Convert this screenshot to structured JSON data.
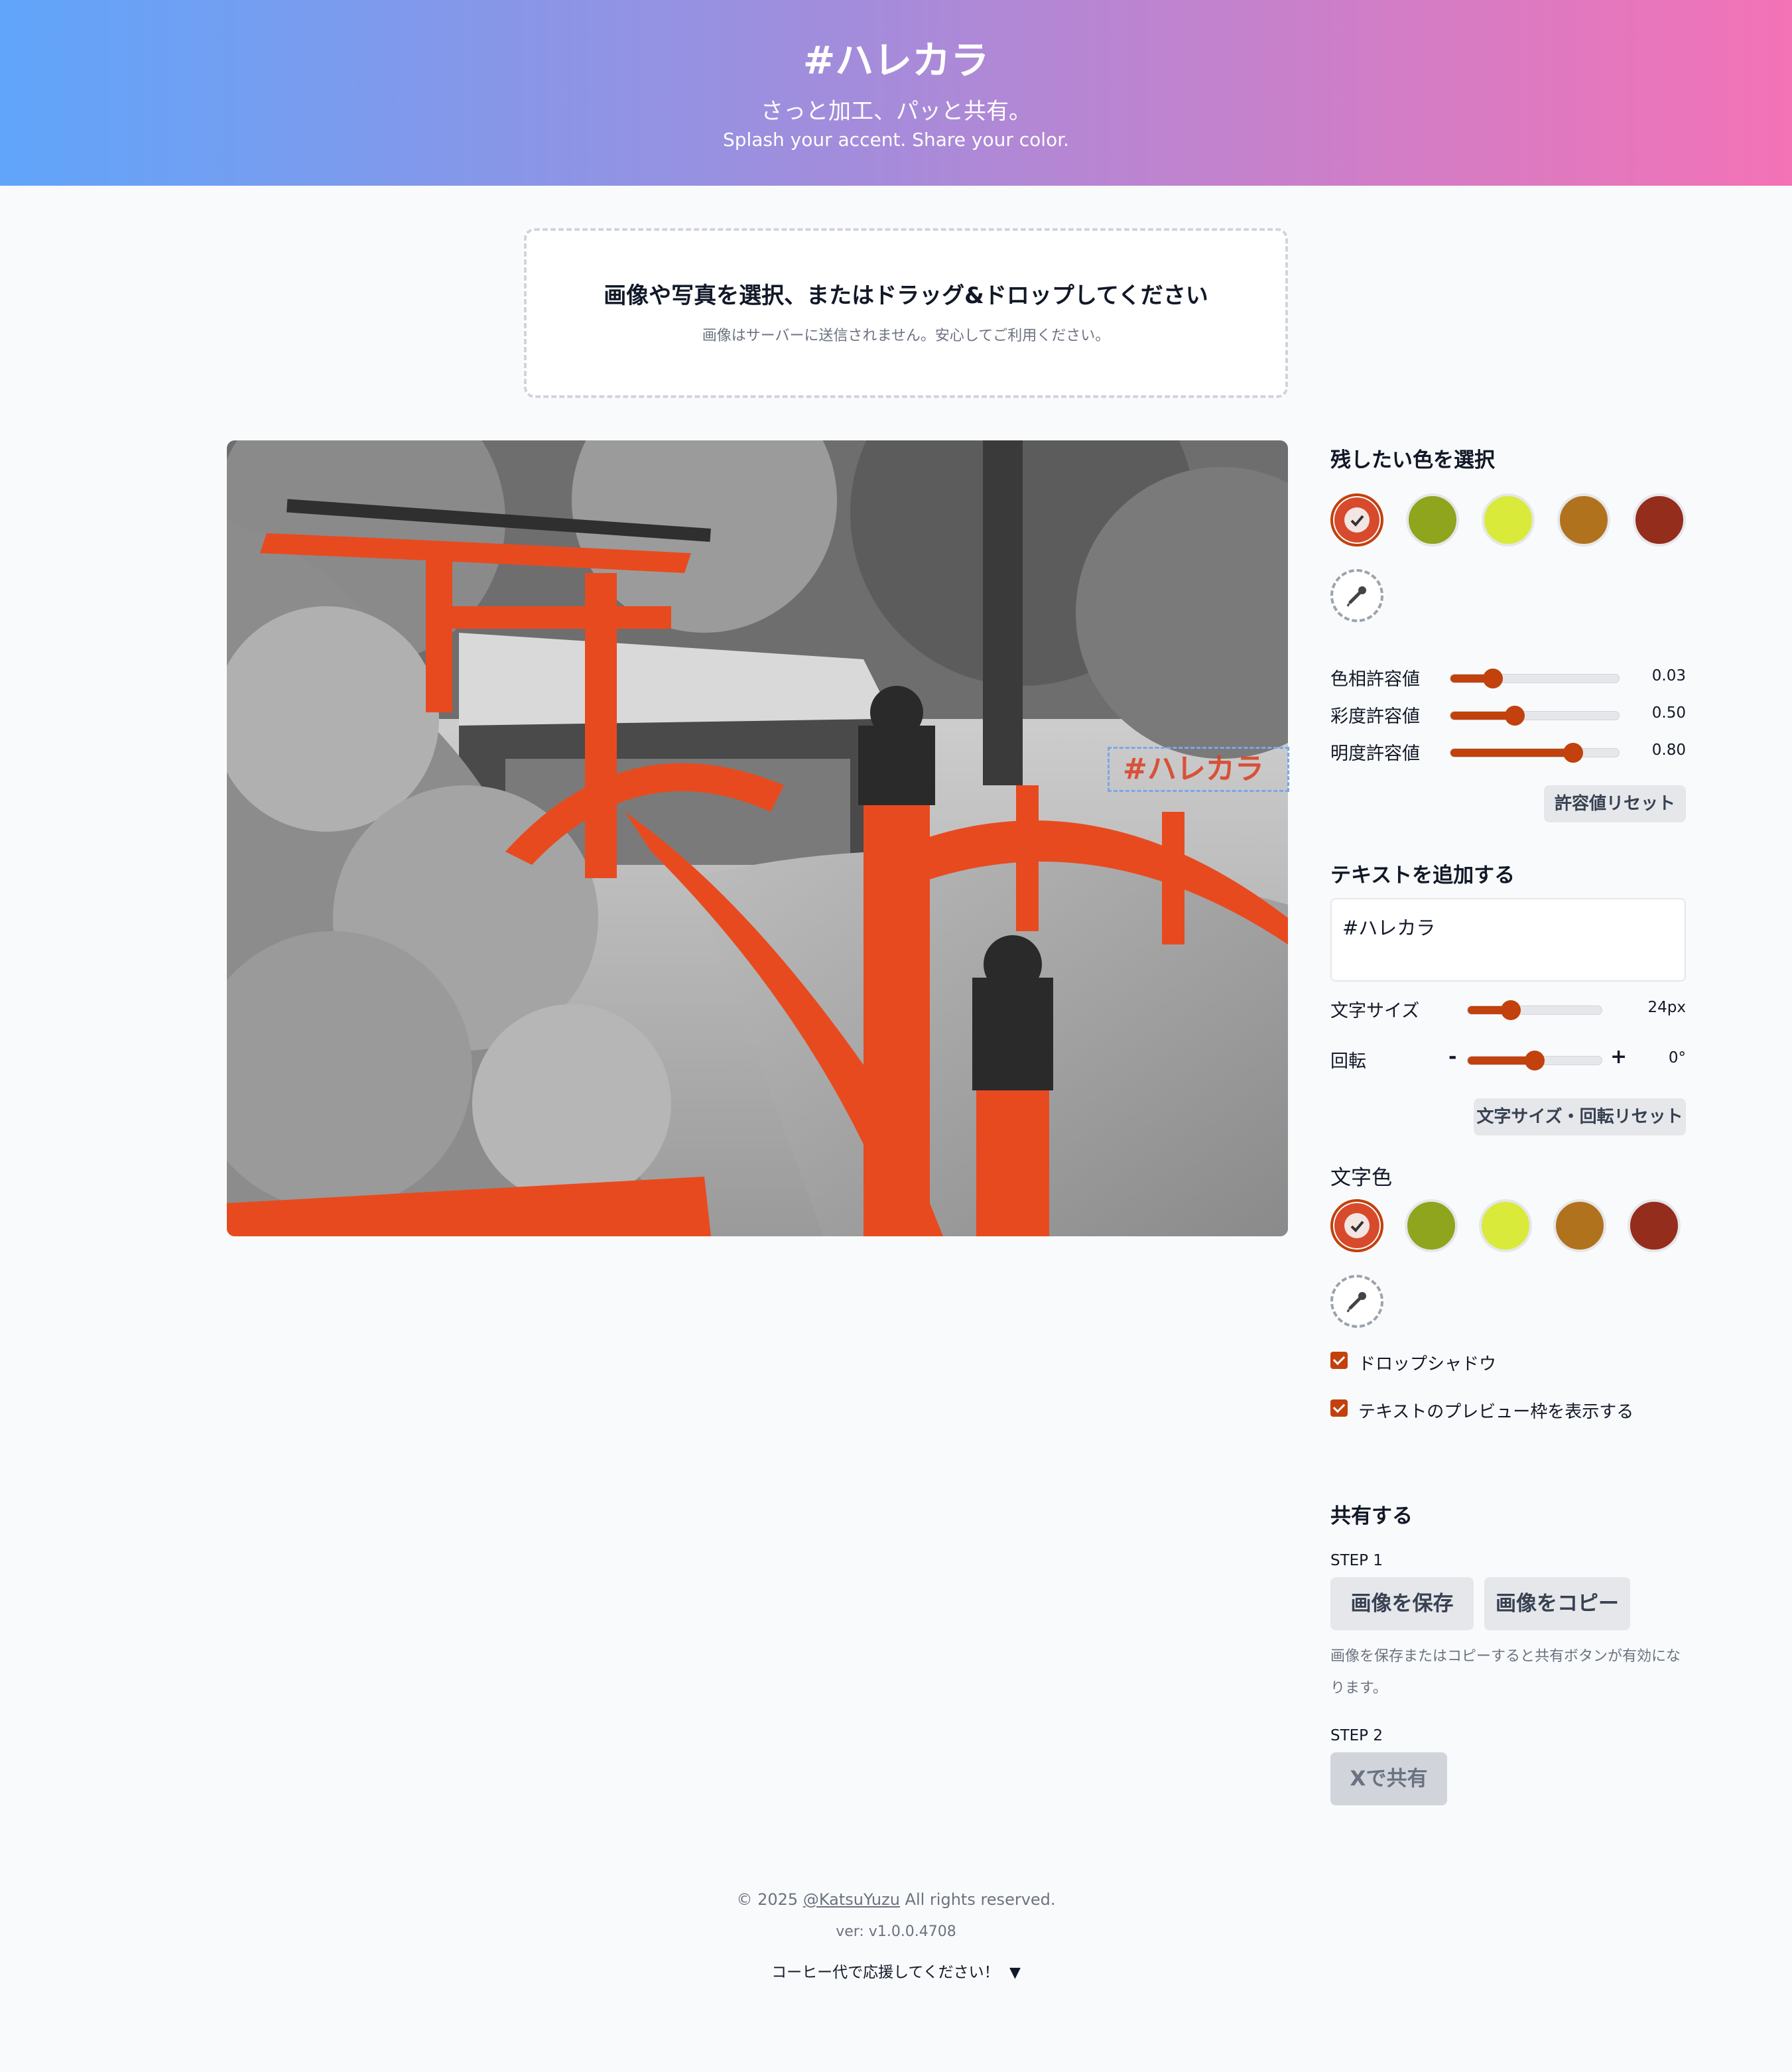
{
  "header": {
    "title": "#ハレカラ",
    "tagline": "さっと加工、パッと共有。",
    "tagline_en": "Splash your accent. Share your color."
  },
  "dropzone": {
    "title": "画像や写真を選択、またはドラッグ&ドロップしてください",
    "note": "画像はサーバーに送信されません。安心してご利用ください。"
  },
  "canvas": {
    "overlay_text": "#ハレカラ"
  },
  "colors": {
    "title": "残したい色を選択",
    "swatches": [
      "#d84a2c",
      "#8fa51e",
      "#d9ea3a",
      "#b1721e",
      "#952d1c"
    ],
    "selected_index": 0
  },
  "tolerance": {
    "hue": {
      "label": "色相許容値",
      "value": "0.03",
      "level": 0.25
    },
    "saturation": {
      "label": "彩度許容値",
      "value": "0.50",
      "level": 0.38
    },
    "brightness": {
      "label": "明度許容値",
      "value": "0.80",
      "level": 0.73
    },
    "reset_label": "許容値リセット"
  },
  "text": {
    "title": "テキストを追加する",
    "value": "#ハレカラ",
    "size": {
      "label": "文字サイズ",
      "value": "24px",
      "level": 0.32
    },
    "rotation": {
      "label": "回転",
      "minus": "-",
      "plus": "+",
      "value": "0°",
      "level": 0.5
    },
    "reset_label": "文字サイズ・回転リセット"
  },
  "text_color": {
    "title": "文字色",
    "swatches": [
      "#d84a2c",
      "#8fa51e",
      "#d9ea3a",
      "#b1721e",
      "#952d1c"
    ],
    "selected_index": 0
  },
  "options": {
    "drop_shadow": {
      "label": "ドロップシャドウ",
      "checked": true
    },
    "preview_frame": {
      "label": "テキストのプレビュー枠を表示する",
      "checked": true
    }
  },
  "share": {
    "title": "共有する",
    "step1": "STEP 1",
    "save_label": "画像を保存",
    "copy_label": "画像をコピー",
    "hint": "画像を保存またはコピーすると共有ボタンが有効になります。",
    "step2": "STEP 2",
    "share_x_label": "Xで共有"
  },
  "footer": {
    "copyright_prefix": "© 2025",
    "author": "@KatsuYuzu",
    "copyright_suffix": "All rights reserved.",
    "version": "ver: v1.0.0.4708",
    "support": "コーヒー代で応援してください！"
  }
}
